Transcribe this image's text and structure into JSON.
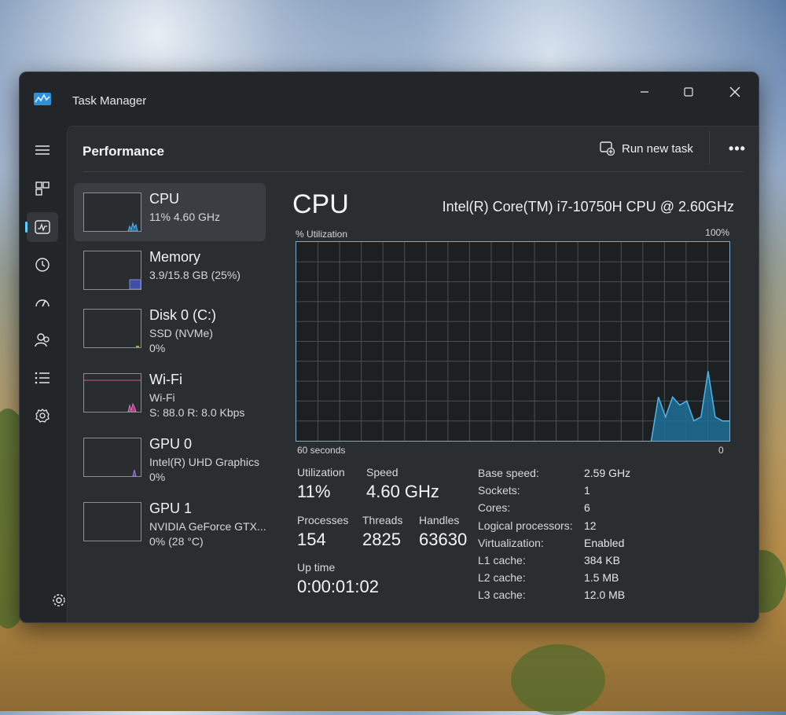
{
  "window": {
    "title": "Task Manager"
  },
  "header": {
    "title": "Performance",
    "run_new_task": "Run new task",
    "more": "•••"
  },
  "sidebar_nav": [
    {
      "name": "hamburger-icon"
    },
    {
      "name": "processes-icon"
    },
    {
      "name": "performance-icon",
      "active": true
    },
    {
      "name": "app-history-icon"
    },
    {
      "name": "startup-apps-icon"
    },
    {
      "name": "users-icon"
    },
    {
      "name": "details-icon"
    },
    {
      "name": "services-icon"
    },
    {
      "name": "settings-icon"
    }
  ],
  "devices": [
    {
      "name": "CPU",
      "line2": "11%  4.60 GHz",
      "line3": ""
    },
    {
      "name": "Memory",
      "line2": "3.9/15.8 GB (25%)",
      "line3": ""
    },
    {
      "name": "Disk 0 (C:)",
      "line2": "SSD (NVMe)",
      "line3": "0%"
    },
    {
      "name": "Wi-Fi",
      "line2": "Wi-Fi",
      "line3": "S: 88.0  R: 8.0 Kbps"
    },
    {
      "name": "GPU 0",
      "line2": "Intel(R) UHD Graphics",
      "line3": "0%"
    },
    {
      "name": "GPU 1",
      "line2": "NVIDIA GeForce GTX...",
      "line3": "0%  (28 °C)"
    }
  ],
  "cpu": {
    "title": "CPU",
    "model": "Intel(R) Core(TM) i7-10750H CPU @ 2.60GHz",
    "graph_y_label": "% Utilization",
    "graph_y_max": "100%",
    "graph_x_label": "60 seconds",
    "graph_x_min": "0",
    "stats": {
      "utilization_label": "Utilization",
      "utilization": "11%",
      "speed_label": "Speed",
      "speed": "4.60 GHz",
      "processes_label": "Processes",
      "processes": "154",
      "threads_label": "Threads",
      "threads": "2825",
      "handles_label": "Handles",
      "handles": "63630",
      "uptime_label": "Up time",
      "uptime": "0:00:01:02"
    },
    "details": [
      {
        "k": "Base speed:",
        "v": "2.59 GHz"
      },
      {
        "k": "Sockets:",
        "v": "1"
      },
      {
        "k": "Cores:",
        "v": "6"
      },
      {
        "k": "Logical processors:",
        "v": "12"
      },
      {
        "k": "Virtualization:",
        "v": "Enabled"
      },
      {
        "k": "L1 cache:",
        "v": "384 KB"
      },
      {
        "k": "L2 cache:",
        "v": "1.5 MB"
      },
      {
        "k": "L3 cache:",
        "v": "12.0 MB"
      }
    ]
  },
  "chart_data": {
    "type": "area",
    "y_range": [
      0,
      100
    ],
    "x_seconds_visible": 60,
    "series": [
      {
        "values": [
          0,
          0,
          0,
          0,
          0,
          0,
          0,
          0,
          0,
          0,
          0,
          0,
          0,
          0,
          0,
          0,
          0,
          0,
          0,
          0,
          0,
          0,
          0,
          0,
          0,
          0,
          0,
          0,
          0,
          0,
          0,
          0,
          0,
          0,
          0,
          0,
          0,
          0,
          0,
          0,
          0,
          0,
          0,
          0,
          0,
          0,
          0,
          0,
          0,
          0,
          0,
          22,
          12,
          22,
          18,
          20,
          10,
          12,
          35,
          12,
          10,
          10
        ]
      }
    ],
    "colors": {
      "line": "#4fb6e8",
      "fill": "#1f6e98",
      "grid": "#4a4f54"
    }
  }
}
